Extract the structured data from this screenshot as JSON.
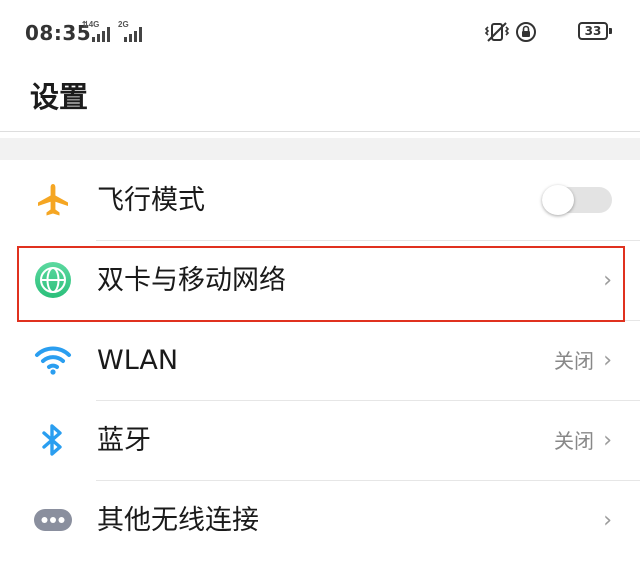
{
  "status_bar": {
    "time": "08:35",
    "sim1_tag": "4G",
    "sim2_tag": "2G",
    "battery_level": "33",
    "icons": [
      "vibrate-icon",
      "rotation-lock-icon",
      "battery-icon"
    ]
  },
  "page": {
    "title": "设置"
  },
  "settings": {
    "airplane": {
      "label": "飞行模式",
      "icon": "airplane-icon",
      "toggle_on": false
    },
    "mobile_network": {
      "label": "双卡与移动网络",
      "icon": "globe-icon",
      "highlighted": true
    },
    "wlan": {
      "label": "WLAN",
      "value": "关闭",
      "icon": "wifi-icon"
    },
    "bluetooth": {
      "label": "蓝牙",
      "value": "关闭",
      "icon": "bluetooth-icon"
    },
    "other_wireless": {
      "label": "其他无线连接",
      "icon": "more-icon"
    }
  },
  "colors": {
    "airplane_icon": "#f5a623",
    "globe_icon": "#3ec98a",
    "wifi_icon": "#2a9ef0",
    "bluetooth_icon": "#2a9ef0",
    "more_icon": "#8a8f9e",
    "highlight_border": "#e0311f"
  }
}
